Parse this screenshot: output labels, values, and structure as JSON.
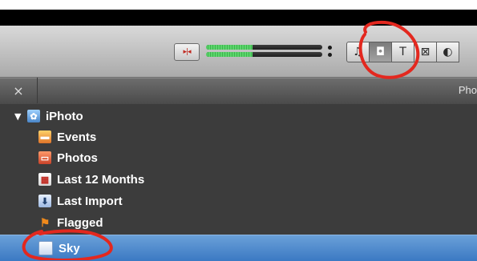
{
  "toolbar": {
    "volume_button_icon": "waveform-icon",
    "level_meter": {
      "left_level": 0.4,
      "right_level": 0.4
    },
    "view_buttons": [
      {
        "icon": "music-note-icon",
        "glyph": "♫",
        "active": false
      },
      {
        "icon": "camera-icon",
        "glyph": "◘",
        "active": true
      },
      {
        "icon": "text-t-icon",
        "glyph": "T",
        "active": false
      },
      {
        "icon": "transition-icon",
        "glyph": "⊠",
        "active": false
      },
      {
        "icon": "partial-icon",
        "glyph": "◐",
        "active": false
      }
    ]
  },
  "header": {
    "close_glyph": "×",
    "title": "Pho"
  },
  "sidebar": {
    "root": {
      "label": "iPhoto",
      "expanded": true,
      "icon": "iphoto-icon"
    },
    "items": [
      {
        "label": "Events",
        "icon": "events-icon",
        "selected": false
      },
      {
        "label": "Photos",
        "icon": "photos-icon",
        "selected": false
      },
      {
        "label": "Last 12 Months",
        "icon": "calendar-icon",
        "selected": false
      },
      {
        "label": "Last Import",
        "icon": "import-icon",
        "selected": false
      },
      {
        "label": "Flagged",
        "icon": "flag-icon",
        "selected": false
      },
      {
        "label": "Sky",
        "icon": "album-icon",
        "selected": true
      }
    ]
  },
  "colors": {
    "selection": "#3b79c3",
    "annotation": "#e3281f",
    "sidebar_bg": "#3c3c3c"
  }
}
